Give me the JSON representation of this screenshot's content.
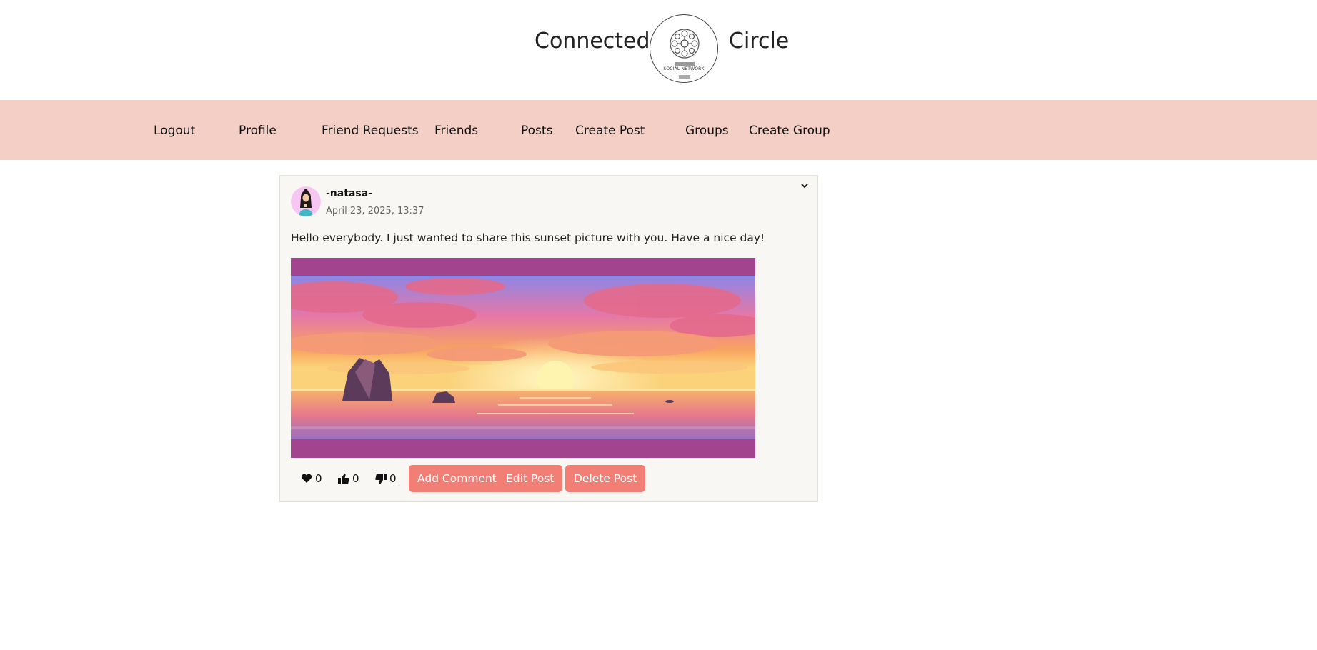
{
  "header": {
    "brand_left": "Connected",
    "brand_right": "Circle",
    "logo_caption": "SOCIAL NETWORK"
  },
  "nav": {
    "items": [
      {
        "label": "Logout"
      },
      {
        "label": "Profile"
      },
      {
        "label": "Friend Requests"
      },
      {
        "label": "Friends"
      },
      {
        "label": "Posts"
      },
      {
        "label": "Create Post"
      },
      {
        "label": "Groups"
      },
      {
        "label": "Create Group"
      }
    ]
  },
  "post": {
    "author": "-natasa-",
    "timestamp": "April 23, 2025, 13:37",
    "text": "Hello everybody. I just wanted to share this sunset picture with you. Have a nice day!",
    "reactions": {
      "hearts": "0",
      "likes": "0",
      "dislikes": "0"
    },
    "buttons": {
      "add_comment": "Add Comment",
      "edit": "Edit Post",
      "delete": "Delete Post"
    }
  },
  "colors": {
    "nav_background": "#f3cfc6",
    "button": "#f27f76",
    "card_background": "#f8f7f4",
    "image_frame": "#a2448e"
  }
}
